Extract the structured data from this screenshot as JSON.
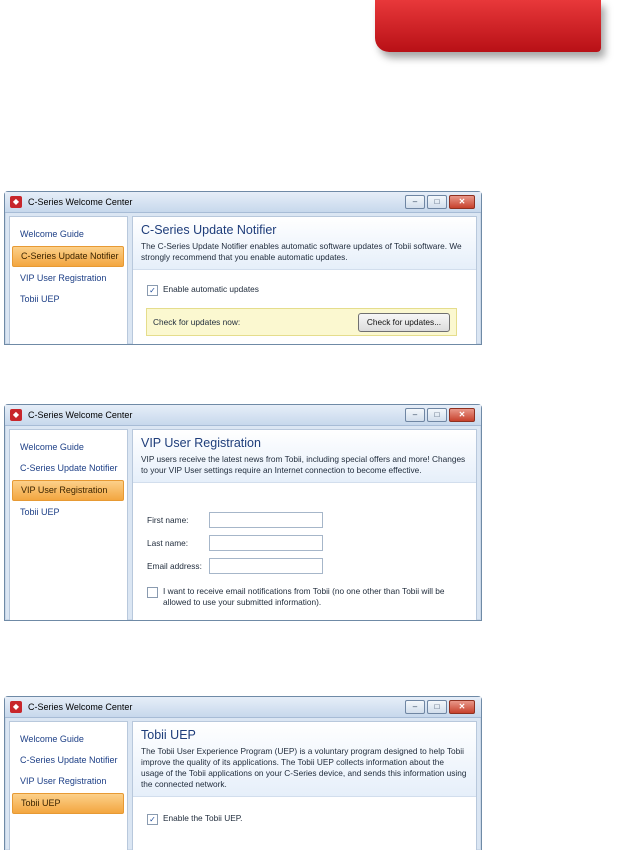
{
  "window": {
    "title": "C-Series Welcome Center",
    "buttons": {
      "minimize": "–",
      "maximize": "□",
      "close": "✕"
    }
  },
  "nav": [
    "Welcome Guide",
    "C-Series Update Notifier",
    "VIP User Registration",
    "Tobii UEP"
  ],
  "screens": [
    {
      "selected": "C-Series Update Notifier",
      "heading": "C-Series Update Notifier",
      "description": "The C-Series Update Notifier enables automatic software updates of Tobii software. We strongly recommend that you enable automatic updates.",
      "checkbox_label": "Enable automatic updates",
      "checkbox_checked": true,
      "check_now_label": "Check for updates now:",
      "check_button": "Check for updates..."
    },
    {
      "selected": "VIP User Registration",
      "heading": "VIP User Registration",
      "description": "VIP users receive the latest news from Tobii, including special offers and more! Changes to your VIP User settings require an Internet connection to become effective.",
      "fields": [
        "First name:",
        "Last name:",
        "Email address:"
      ],
      "checkbox_label": "I want to receive email notifications from Tobii (no one other than Tobii will be allowed to use your submitted information).",
      "checkbox_checked": false
    },
    {
      "selected": "Tobii UEP",
      "heading": "Tobii UEP",
      "description": "The Tobii User Experience Program (UEP) is a voluntary program designed to help Tobii improve the quality of its applications. The Tobii UEP collects information about the usage of the Tobii applications on your C-Series device, and sends this information using the connected network.",
      "checkbox_label": "Enable the Tobii UEP.",
      "checkbox_checked": true
    }
  ],
  "colors": {
    "accent_red": "#c8262b",
    "selected_nav": "#f3a640",
    "link_blue": "#1d3f86"
  }
}
